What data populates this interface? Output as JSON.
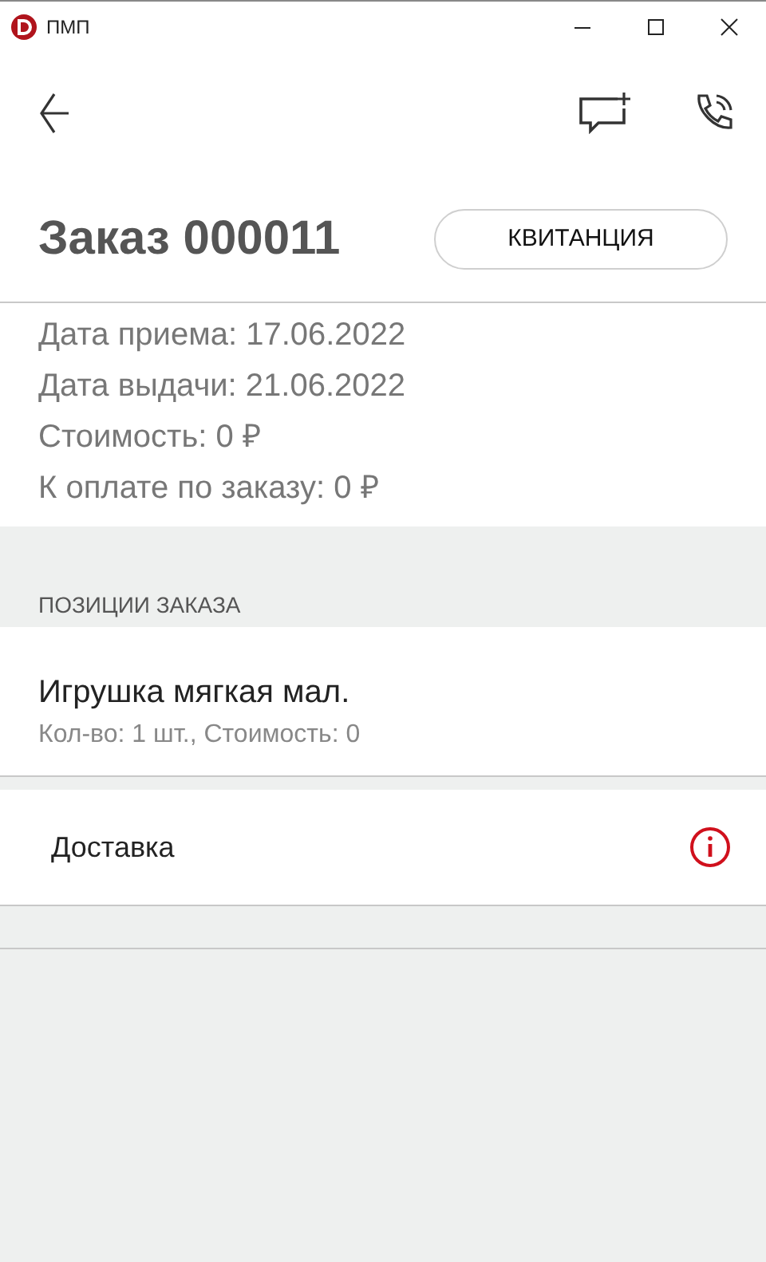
{
  "window": {
    "title": "ПМП"
  },
  "order": {
    "title": "Заказ 000011",
    "receipt_button": "КВИТАНЦИЯ",
    "details": [
      "Дата приема: 17.06.2022",
      "Дата выдачи: 21.06.2022",
      "Стоимость: 0 ₽",
      "К оплате по заказу: 0 ₽"
    ]
  },
  "positions": {
    "heading": "ПОЗИЦИИ ЗАКАЗА",
    "items": [
      {
        "name": "Игрушка мягкая мал.",
        "details": "Кол-во: 1 шт., Стоимость: 0"
      }
    ]
  },
  "delivery": {
    "label": "Доставка"
  }
}
